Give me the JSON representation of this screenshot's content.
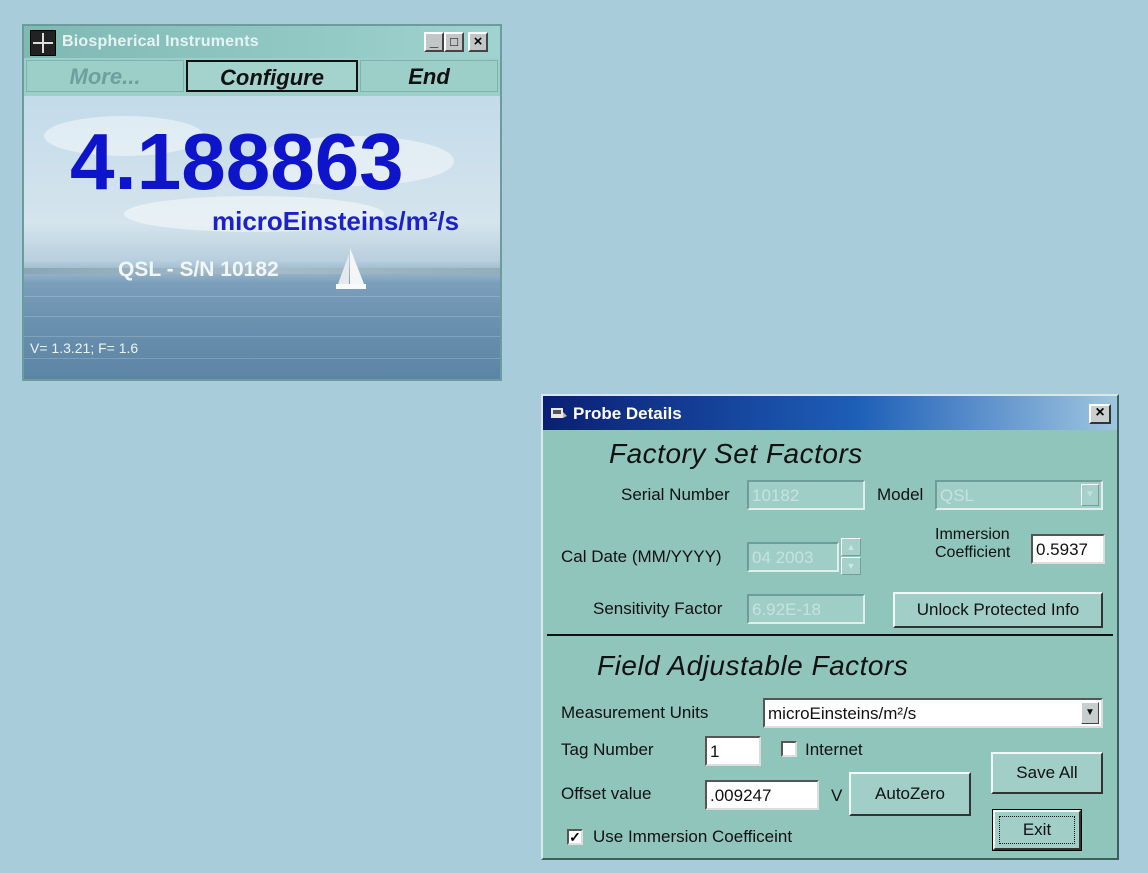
{
  "app_window": {
    "title": "Biospherical Instruments",
    "menu": {
      "more_label": "More...",
      "configure_label": "Configure",
      "end_label": "End"
    },
    "reading_value": "4.188863",
    "reading_units": "microEinsteins/m²/s",
    "probe_label": "QSL - S/N 10182",
    "version_text": "V= 1.3.21; F= 1.6",
    "caption_buttons": [
      "_",
      "□",
      "×"
    ]
  },
  "probe_dialog": {
    "title": "Probe Details",
    "factory_section_title": "Factory Set Factors",
    "serial_label": "Serial Number",
    "serial_value": "10182",
    "model_label": "Model",
    "model_value": "QSL",
    "cal_date_label": "Cal Date (MM/YYYY)",
    "cal_date_value": "04 2003",
    "immersion_label_line1": "Immersion",
    "immersion_label_line2": "Coefficient",
    "immersion_value": "0.5937",
    "sensitivity_label": "Sensitivity  Factor",
    "sensitivity_value": "6.92E-18",
    "unlock_button": "Unlock Protected Info",
    "field_section_title": "Field Adjustable Factors",
    "units_label": "Measurement Units",
    "units_value": "microEinsteins/m²/s",
    "tag_label": "Tag Number",
    "tag_value": "1",
    "internet_label": "Internet",
    "internet_checked": false,
    "offset_label": "Offset value",
    "offset_value": ".009247",
    "offset_unit": "V",
    "autozero_button": "AutoZero",
    "save_all_button": "Save All",
    "exit_button": "Exit",
    "use_immersion_label": "Use Immersion Coefficeint",
    "use_immersion_checked": true
  },
  "colors": {
    "desktop": "#a9ccdb",
    "reading": "#0d14c9",
    "dialog_title_start": "#0a1f74",
    "dialog_body": "#90c5bc"
  }
}
